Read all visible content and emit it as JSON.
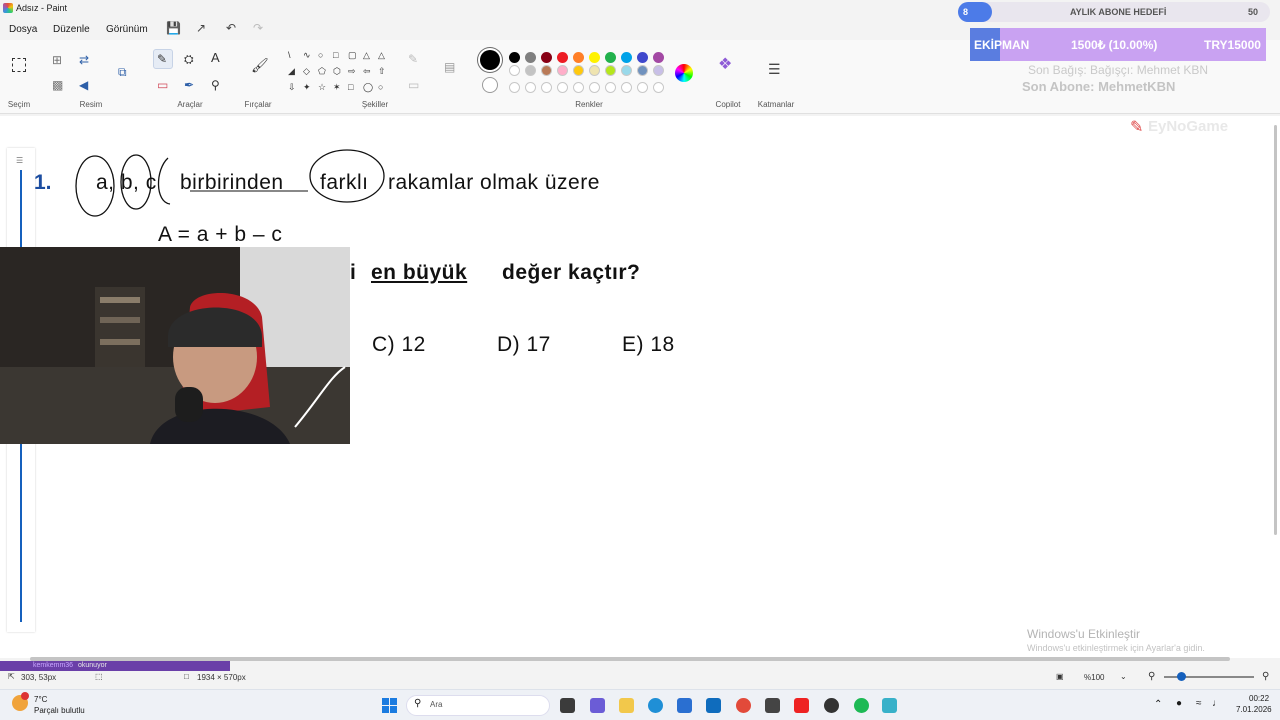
{
  "window": {
    "title": "Adsız - Paint"
  },
  "menu": {
    "items": [
      "Dosya",
      "Düzenle",
      "Görünüm"
    ]
  },
  "ribbon": {
    "groups": [
      "Seçim",
      "Resim",
      "Araçlar",
      "Fırçalar",
      "Şekiller",
      "Renkler",
      "Copilot",
      "Katmanlar"
    ],
    "text_tool": "A"
  },
  "colors": {
    "palette_row1": [
      "#000000",
      "#7f7f7f",
      "#880015",
      "#ed1c24",
      "#ff7f27",
      "#fff200",
      "#22b14c",
      "#00a2e8",
      "#3f48cc",
      "#a349a4"
    ],
    "palette_row2": [
      "#ffffff",
      "#c3c3c3",
      "#b97a57",
      "#ffaec9",
      "#ffc90e",
      "#efe4b0",
      "#b5e61d",
      "#99d9ea",
      "#7092be",
      "#c8bfe7"
    ],
    "primary": "#000000",
    "secondary": "#ffffff"
  },
  "question": {
    "number": "1.",
    "line1_letters": "a, b, c",
    "line1_word1": "birbirinden",
    "line1_word2": "farklı",
    "line1_rest": "rakamlar olmak üzere",
    "formula": "A = a + b – c",
    "line3_partial": "i",
    "line3_underlined": "en büyük",
    "line3_rest": "değer kaçtır?",
    "options": [
      "C) 12",
      "D) 17",
      "E) 18"
    ]
  },
  "overlay": {
    "goal_title": "AYLIK ABONE HEDEFİ",
    "goal_left": "8",
    "goal_right": "50",
    "ekipman_label": "EKİPMAN",
    "ekipman_progress": "1500₺ (10.00%)",
    "ekipman_target": "TRY15000",
    "last_sub": "Son Abone: MehmetKBN",
    "faded_line": "Son Bağış: Bağışçı: Mehmet KBN",
    "brand": "EyNoGame"
  },
  "watermark": {
    "title": "Windows'u Etkinleştir",
    "subtitle": "Windows'u etkinleştirmek için Ayarlar'a gidin."
  },
  "status": {
    "cursor_pos": "303, 53px",
    "canvas_size": "1934 × 570px",
    "zoom": "%100",
    "chat_user": "kemkemm36",
    "chat_status": "okunuyor"
  },
  "taskbar": {
    "weather_temp": "7°C",
    "weather_desc": "Parçalı bulutlu",
    "search_placeholder": "Ara",
    "time": "00:22",
    "date": "7.01.2026"
  }
}
